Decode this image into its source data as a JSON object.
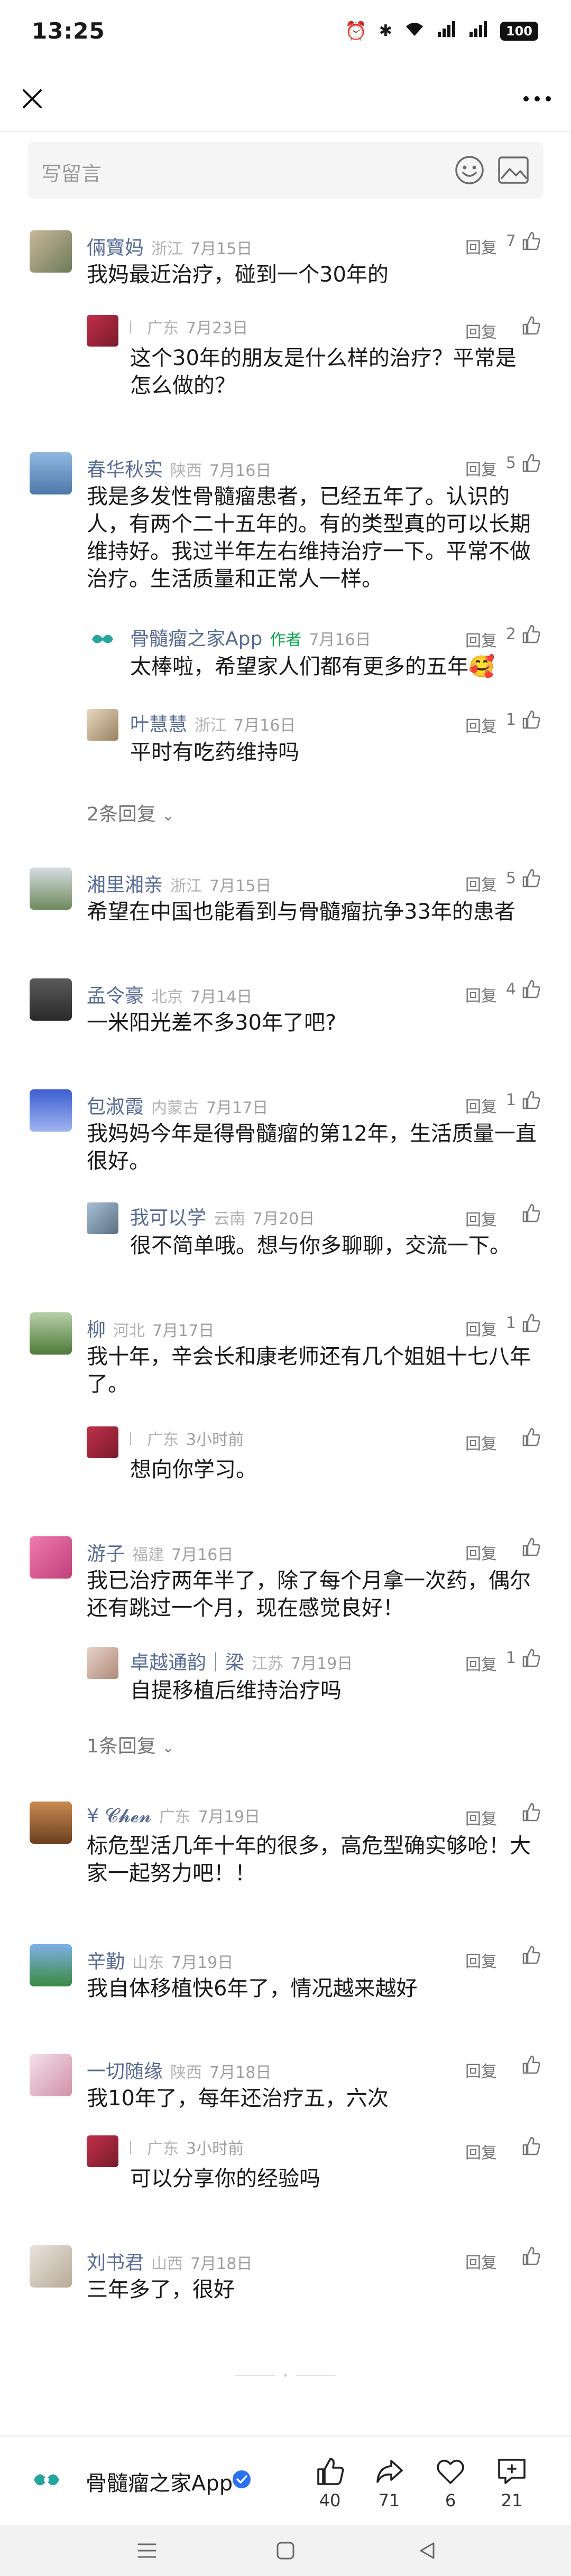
{
  "status": {
    "time": "13:25",
    "battery": "100"
  },
  "input": {
    "placeholder": "写留言"
  },
  "comments": [
    {
      "user": "倆寶妈",
      "loc": "浙江",
      "date": "7月15日",
      "reply": "回复",
      "likes": "7",
      "text": "我妈最近治疗，碰到一个30年的"
    },
    {
      "user": "",
      "loc": "广东",
      "date": "7月23日",
      "reply": "回复",
      "likes": "",
      "text": "这个30年的朋友是什么样的治疗？平常是怎么做的？"
    },
    {
      "user": "春华秋实",
      "loc": "陕西",
      "date": "7月16日",
      "reply": "回复",
      "likes": "5",
      "text": "我是多发性骨髓瘤患者，已经五年了。认识的人，有两个二十五年的。有的类型真的可以长期维持好。我过半年左右维持治疗一下。平常不做治疗。生活质量和正常人一样。"
    },
    {
      "user": "骨髓瘤之家App",
      "author": "作者",
      "loc": "",
      "date": "7月16日",
      "reply": "回复",
      "likes": "2",
      "text": "太棒啦，希望家人们都有更多的五年🥰"
    },
    {
      "user": "叶慧慧",
      "loc": "浙江",
      "date": "7月16日",
      "reply": "回复",
      "likes": "1",
      "text": "平时有吃药维持吗"
    },
    {
      "more": "2条回复"
    },
    {
      "user": "湘里湘亲",
      "loc": "浙江",
      "date": "7月15日",
      "reply": "回复",
      "likes": "5",
      "text": "希望在中国也能看到与骨髓瘤抗争33年的患者"
    },
    {
      "user": "孟令豪",
      "loc": "北京",
      "date": "7月14日",
      "reply": "回复",
      "likes": "4",
      "text": "一米阳光差不多30年了吧?"
    },
    {
      "user": "包淑霞",
      "loc": "内蒙古",
      "date": "7月17日",
      "reply": "回复",
      "likes": "1",
      "text": "我妈妈今年是得骨髓瘤的第12年，生活质量一直很好。"
    },
    {
      "user": "我可以学",
      "loc": "云南",
      "date": "7月20日",
      "reply": "回复",
      "likes": "",
      "text": "很不简单哦。想与你多聊聊，交流一下。"
    },
    {
      "user": "柳",
      "loc": "河北",
      "date": "7月17日",
      "reply": "回复",
      "likes": "1",
      "text": "我十年，辛会长和康老师还有几个姐姐十七八年了。"
    },
    {
      "user": "",
      "loc": "广东",
      "date": "3小时前",
      "reply": "回复",
      "likes": "",
      "text": "想向你学习。"
    },
    {
      "user": "游子",
      "loc": "福建",
      "date": "7月16日",
      "reply": "回复",
      "likes": "",
      "text": "我已治疗两年半了，除了每个月拿一次药，偶尔还有跳过一个月，现在感觉良好！"
    },
    {
      "user": "卓越通韵｜梁",
      "loc": "江苏",
      "date": "7月19日",
      "reply": "回复",
      "likes": "1",
      "text": "自提移植后维持治疗吗"
    },
    {
      "more": "1条回复"
    },
    {
      "user": "¥ 𝓒𝓱𝓮𝓷",
      "loc": "广东",
      "date": "7月19日",
      "reply": "回复",
      "likes": "",
      "text": "标危型活几年十年的很多，高危型确实够呛！大家一起努力吧！！"
    },
    {
      "user": "辛勤",
      "loc": "山东",
      "date": "7月19日",
      "reply": "回复",
      "likes": "",
      "text": "我自体移植快6年了，情况越来越好"
    },
    {
      "user": "一切随缘",
      "loc": "陕西",
      "date": "7月18日",
      "reply": "回复",
      "likes": "",
      "text": "我10年了，每年还治疗五，六次"
    },
    {
      "user": "",
      "loc": "广东",
      "date": "3小时前",
      "reply": "回复",
      "likes": "",
      "text": "可以分享你的经验吗"
    },
    {
      "user": "刘书君",
      "loc": "山西",
      "date": "7月18日",
      "reply": "回复",
      "likes": "",
      "text": "三年多了，很好"
    }
  ],
  "footer": {
    "brand": "骨髓瘤之家App",
    "likes": "40",
    "shares": "71",
    "favorites": "6",
    "comments": "21"
  },
  "colors": {
    "accent": "#576b95",
    "author": "#0aa84f",
    "verified": "#2b6ff6"
  }
}
